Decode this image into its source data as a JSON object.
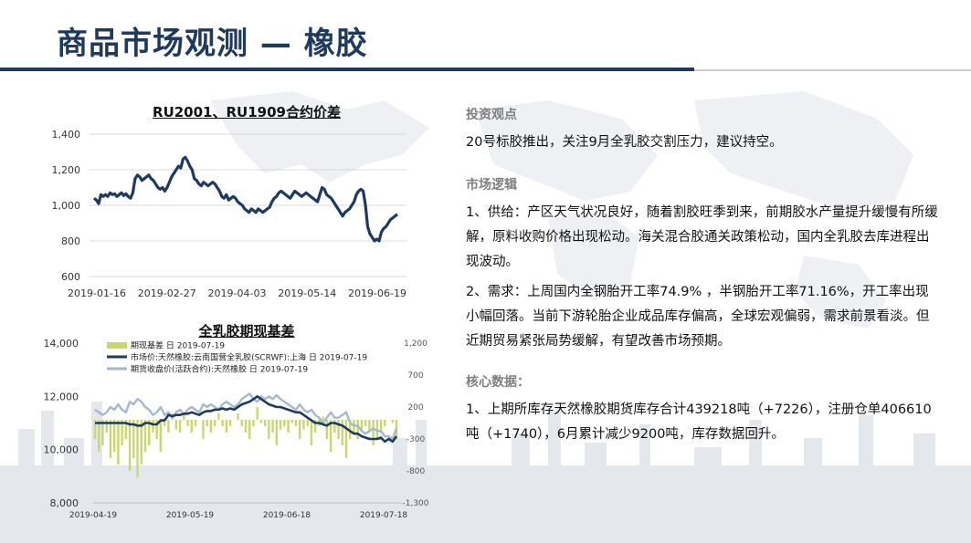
{
  "page": {
    "title": "商品市场观测 — 橡胶"
  },
  "right": {
    "view_head": "投资观点",
    "view_text": "20号标胶推出，关注9月全乳胶交割压力，建议持空。",
    "logic_head": "市场逻辑",
    "logic_1": "1、供给：产区天气状况良好，随着割胶旺季到来，前期胶水产量提升缓慢有所缓解，原料收购价格出现松动。海关混合胶通关政策松动，国内全乳胶去库进程出现波动。",
    "logic_2": "2、需求：上周国内全钢胎开工率74.9% ，半钢胎开工率71.16%，开工率出现小幅回落。当前下游轮胎企业成品库存偏高，全球宏观偏弱，需求前景看淡。但近期贸易紧张局势缓解，有望改善市场预期。",
    "core_head": "核心数据：",
    "core_1": "1、上期所库存天然橡胶期货库存合计439218吨（+7226），注册仓单406610吨（+1740），6月累计减少9200吨，库存数据回升。"
  },
  "chart_data": [
    {
      "type": "line",
      "title": "RU2001、RU1909合约价差",
      "x_ticks": [
        "2019-01-16",
        "2019-02-27",
        "2019-04-03",
        "2019-05-14",
        "2019-06-19"
      ],
      "y_ticks": [
        "1,400",
        "1,200",
        "1,000",
        "800",
        "600"
      ],
      "ylim": [
        600,
        1400
      ],
      "grid": true,
      "series": [
        {
          "color": "#1f3a5f",
          "values": [
            1040,
            1030,
            1010,
            1060,
            1050,
            1060,
            1050,
            1070,
            1060,
            1065,
            1050,
            1060,
            1070,
            1055,
            1065,
            1050,
            1040,
            1070,
            1150,
            1170,
            1160,
            1140,
            1150,
            1160,
            1170,
            1150,
            1140,
            1120,
            1100,
            1090,
            1100,
            1080,
            1100,
            1130,
            1160,
            1180,
            1200,
            1220,
            1210,
            1260,
            1270,
            1250,
            1220,
            1200,
            1150,
            1140,
            1120,
            1110,
            1130,
            1120,
            1110,
            1120,
            1130,
            1120,
            1100,
            1080,
            1050,
            1040,
            1060,
            1030,
            1040,
            1050,
            1040,
            1020,
            1010,
            1000,
            980,
            970,
            960,
            980,
            970,
            960,
            980,
            970,
            960,
            970,
            980,
            990,
            1020,
            1040,
            1050,
            1070,
            1080,
            1070,
            1060,
            1050,
            1040,
            1060,
            1080,
            1070,
            1060,
            1050,
            1060,
            1070,
            1060,
            1050,
            1040,
            1030,
            1020,
            1060,
            1100,
            1090,
            1060,
            1050,
            1040,
            1020,
            1000,
            980,
            960,
            940,
            960,
            970,
            980,
            1000,
            1020,
            1060,
            1080,
            1090,
            1080,
            1000,
            880,
            840,
            820,
            800,
            810,
            800,
            850,
            870,
            880,
            900,
            920,
            930,
            940,
            950
          ]
        }
      ]
    },
    {
      "type": "bar+line",
      "title": "全乳胶期现基差",
      "legend": [
        "期现基差 日 2019-07-19",
        "市场价:天然橡胶:云南国营全乳胶(SCRWF):上海 日 2019-07-19",
        "期货收盘价(活跃合约):天然橡胶 日 2019-07-19"
      ],
      "x_ticks": [
        "2019-04-19",
        "2019-05-19",
        "2019-06-18",
        "2019-07-18"
      ],
      "y_left_ticks": [
        "14,000",
        "12,000",
        "10,000",
        "8,000"
      ],
      "y_right_ticks": [
        "1,200",
        "700",
        "200",
        "-300",
        "-800",
        "-1,300"
      ],
      "ylim_left": [
        8000,
        14000
      ],
      "ylim_right": [
        -1300,
        1200
      ],
      "series": [
        {
          "name": "期现基差 日 2019-07-19",
          "kind": "bar",
          "axis": "right",
          "color": "#c8d96b",
          "values": [
            -300,
            -500,
            -400,
            -200,
            -600,
            -500,
            -700,
            -400,
            -300,
            -800,
            -600,
            -900,
            -700,
            -500,
            -400,
            -200,
            -300,
            -500,
            -100,
            -200,
            100,
            -150,
            -200,
            100,
            -100,
            -200,
            -100,
            0,
            -300,
            -100,
            -200,
            -100,
            100,
            -100,
            -200,
            -100,
            0,
            100,
            -100,
            -200,
            -300,
            -100,
            200,
            -50,
            -100,
            -300,
            -200,
            -400,
            -150,
            -100,
            -200,
            -50,
            -100,
            -300,
            -150,
            -100,
            -400,
            -200,
            -100,
            50,
            -300,
            -500,
            -200,
            -300,
            -400,
            -600,
            -300,
            -200,
            -300,
            -150,
            -100,
            -200,
            -400,
            -300,
            -200,
            -100,
            0,
            -50,
            -300
          ]
        },
        {
          "name": "市场价:天然橡胶:云南国营全乳胶(SCRWF):上海 日 2019-07-19",
          "kind": "line",
          "axis": "left",
          "color": "#1f3a5f",
          "values": [
            11000,
            11000,
            11000,
            11000,
            11000,
            11000,
            11000,
            11000,
            11000,
            10950,
            10950,
            10900,
            10900,
            11000,
            11000,
            10950,
            10950,
            11100,
            11100,
            11300,
            11250,
            11300,
            11300,
            11350,
            11350,
            11400,
            11350,
            11300,
            11400,
            11450,
            11450,
            11500,
            11500,
            11550,
            11500,
            11550,
            11500,
            11600,
            11700,
            11750,
            11800,
            11900,
            12000,
            11900,
            11800,
            11700,
            11650,
            11600,
            11600,
            11550,
            11500,
            11450,
            11400,
            11400,
            11300,
            11200,
            11100,
            11000,
            11000,
            10950,
            10900,
            11000,
            11000,
            10950,
            10900,
            10800,
            10700,
            10600,
            10600,
            10500,
            10450,
            10400,
            10400,
            10400,
            10450,
            10300,
            10400,
            10300,
            10500
          ]
        },
        {
          "name": "期货收盘价(活跃合约):天然橡胶 日 2019-07-19",
          "kind": "line",
          "axis": "left",
          "color": "#a4b8cf",
          "values": [
            11500,
            11400,
            11300,
            11400,
            11600,
            11500,
            11700,
            11500,
            11400,
            11800,
            11700,
            11900,
            11800,
            11600,
            11500,
            11300,
            11400,
            11600,
            11300,
            11400,
            11200,
            11400,
            11500,
            11300,
            11500,
            11600,
            11500,
            11400,
            11700,
            11600,
            11700,
            11600,
            11500,
            11700,
            11800,
            11700,
            11600,
            11700,
            11900,
            12000,
            12100,
            11900,
            11800,
            12000,
            11900,
            12000,
            11900,
            12050,
            11900,
            11800,
            11700,
            11600,
            11500,
            11700,
            11500,
            11400,
            11500,
            11300,
            11200,
            11000,
            11200,
            11400,
            11200,
            11200,
            11300,
            11400,
            11000,
            10900,
            10900,
            10700,
            10600,
            10700,
            10800,
            10700,
            10700,
            10500,
            10500,
            10400,
            10800
          ]
        }
      ]
    }
  ]
}
